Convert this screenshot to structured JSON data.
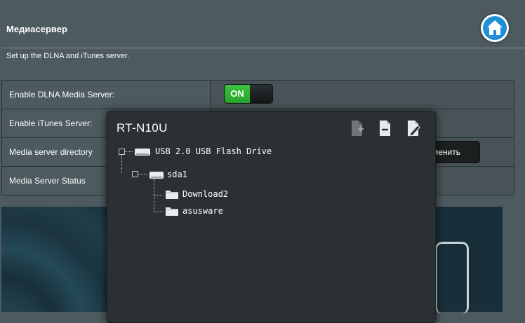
{
  "header": {
    "title": "Медиасервер",
    "subtitle": "Set up the DLNA and iTunes server."
  },
  "settings": {
    "rows": [
      {
        "label": "Enable DLNA Media Server:"
      },
      {
        "label": "Enable iTunes Server:"
      },
      {
        "label": "Media server directory"
      },
      {
        "label": "Media Server Status"
      }
    ],
    "dlna_toggle": "ON",
    "apply_button": "менить"
  },
  "popup": {
    "title": "RT-N10U",
    "tree": {
      "drive": "USB 2.0 USB Flash Drive",
      "partition": "sda1",
      "folders": [
        "Download2",
        "asusware"
      ]
    }
  },
  "icons": {
    "home": "home-icon",
    "add_folder": "add-folder-icon",
    "delete": "delete-icon",
    "rename": "rename-icon",
    "drive": "usb-drive-icon",
    "folder": "folder-icon"
  },
  "colors": {
    "background": "#4d5a5f",
    "toggle_on": "#2fb332",
    "home_blue": "#1f8fd6",
    "popup_bg": "#2b3133"
  }
}
